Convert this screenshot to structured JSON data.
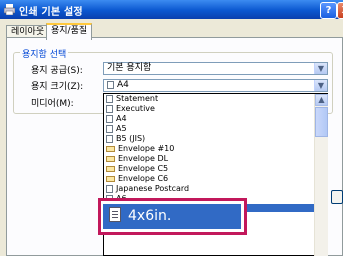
{
  "window": {
    "title": "인쇄 기본 설정",
    "help": "?",
    "close": "X"
  },
  "tabs": [
    {
      "label": "레이아웃"
    },
    {
      "label": "용지/품질"
    }
  ],
  "paper_select": {
    "group_label": "용지함 선택",
    "source_label": "용지 공급(S):",
    "source_value": "기본 용지함",
    "size_label": "용지 크기(Z):",
    "size_value": "A4",
    "media_label": "미디어(M):"
  },
  "size_options": [
    {
      "label": "Statement",
      "icon": "page-icon"
    },
    {
      "label": "Executive",
      "icon": "page-icon"
    },
    {
      "label": "A4",
      "icon": "page-icon"
    },
    {
      "label": "A5",
      "icon": "page-icon"
    },
    {
      "label": "B5 (JIS)",
      "icon": "page-icon"
    },
    {
      "label": "Envelope #10",
      "icon": "envelope-icon"
    },
    {
      "label": "Envelope DL",
      "icon": "envelope-icon"
    },
    {
      "label": "Envelope C5",
      "icon": "envelope-icon"
    },
    {
      "label": "Envelope C6",
      "icon": "envelope-icon"
    },
    {
      "label": "Japanese Postcard",
      "icon": "page-icon"
    },
    {
      "label": "A6",
      "icon": "page-icon"
    }
  ],
  "highlighted_option": "4x6in.",
  "colors": {
    "title_bar": "#0b57d0",
    "selection": "#316ac5",
    "zoom_border": "#c2185b",
    "group_label": "#0046d5"
  }
}
